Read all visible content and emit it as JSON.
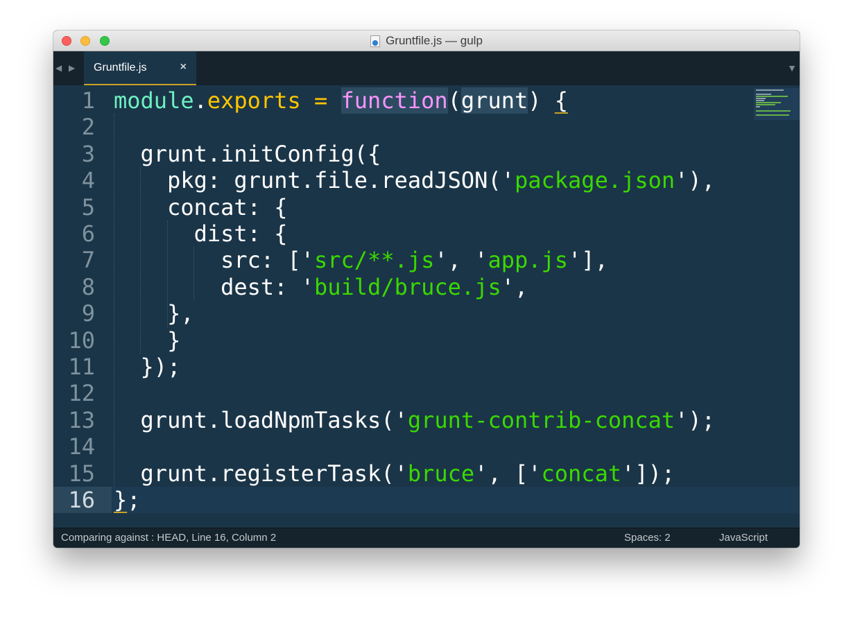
{
  "window": {
    "title": "Gruntfile.js — gulp"
  },
  "tabs": [
    {
      "label": "Gruntfile.js",
      "close": "×"
    }
  ],
  "tabbar": {
    "prev_glyph": "◀",
    "next_glyph": "▶",
    "menu_glyph": "▼"
  },
  "editor": {
    "active_line": 16,
    "lines": [
      {
        "num": "1",
        "tokens": [
          {
            "t": "module",
            "c": "#6ef0c2"
          },
          {
            "t": ".",
            "c": "#ffffff"
          },
          {
            "t": "exports",
            "c": "#ffc600"
          },
          {
            "t": " = ",
            "c": "#ffc600"
          },
          {
            "t": "function",
            "c": "#fb94ff",
            "hl": true
          },
          {
            "t": "(",
            "c": "#ffffff"
          },
          {
            "t": "grunt",
            "c": "#ffffff",
            "hl": true
          },
          {
            "t": ") ",
            "c": "#ffffff"
          },
          {
            "t": "{",
            "c": "#ffffff",
            "u": true
          }
        ]
      },
      {
        "num": "2",
        "tokens": []
      },
      {
        "num": "3",
        "tokens": [
          {
            "t": "  grunt.initConfig({",
            "c": "#ffffff"
          }
        ]
      },
      {
        "num": "4",
        "tokens": [
          {
            "t": "    pkg: grunt.file.readJSON(",
            "c": "#ffffff"
          },
          {
            "t": "'",
            "c": "#ffffff"
          },
          {
            "t": "package.json",
            "c": "#3ad900"
          },
          {
            "t": "'",
            "c": "#ffffff"
          },
          {
            "t": "),",
            "c": "#ffffff"
          }
        ]
      },
      {
        "num": "5",
        "tokens": [
          {
            "t": "    concat: {",
            "c": "#ffffff"
          }
        ]
      },
      {
        "num": "6",
        "tokens": [
          {
            "t": "      dist: {",
            "c": "#ffffff"
          }
        ]
      },
      {
        "num": "7",
        "tokens": [
          {
            "t": "        src: [",
            "c": "#ffffff"
          },
          {
            "t": "'",
            "c": "#ffffff"
          },
          {
            "t": "src/**.js",
            "c": "#3ad900"
          },
          {
            "t": "'",
            "c": "#ffffff"
          },
          {
            "t": ", ",
            "c": "#ffffff"
          },
          {
            "t": "'",
            "c": "#ffffff"
          },
          {
            "t": "app.js",
            "c": "#3ad900"
          },
          {
            "t": "'",
            "c": "#ffffff"
          },
          {
            "t": "],",
            "c": "#ffffff"
          }
        ]
      },
      {
        "num": "8",
        "tokens": [
          {
            "t": "        dest: ",
            "c": "#ffffff"
          },
          {
            "t": "'",
            "c": "#ffffff"
          },
          {
            "t": "build/bruce.js",
            "c": "#3ad900"
          },
          {
            "t": "'",
            "c": "#ffffff"
          },
          {
            "t": ",",
            "c": "#ffffff"
          }
        ]
      },
      {
        "num": "9",
        "tokens": [
          {
            "t": "    },",
            "c": "#ffffff"
          }
        ]
      },
      {
        "num": "10",
        "tokens": [
          {
            "t": "    }",
            "c": "#ffffff"
          }
        ]
      },
      {
        "num": "11",
        "tokens": [
          {
            "t": "  });",
            "c": "#ffffff"
          }
        ]
      },
      {
        "num": "12",
        "tokens": []
      },
      {
        "num": "13",
        "tokens": [
          {
            "t": "  grunt.loadNpmTasks(",
            "c": "#ffffff"
          },
          {
            "t": "'",
            "c": "#ffffff"
          },
          {
            "t": "grunt-contrib-concat",
            "c": "#3ad900"
          },
          {
            "t": "'",
            "c": "#ffffff"
          },
          {
            "t": ");",
            "c": "#ffffff"
          }
        ]
      },
      {
        "num": "14",
        "tokens": []
      },
      {
        "num": "15",
        "tokens": [
          {
            "t": "  grunt.registerTask(",
            "c": "#ffffff"
          },
          {
            "t": "'",
            "c": "#ffffff"
          },
          {
            "t": "bruce",
            "c": "#3ad900"
          },
          {
            "t": "'",
            "c": "#ffffff"
          },
          {
            "t": ", [",
            "c": "#ffffff"
          },
          {
            "t": "'",
            "c": "#ffffff"
          },
          {
            "t": "concat",
            "c": "#3ad900"
          },
          {
            "t": "'",
            "c": "#ffffff"
          },
          {
            "t": "]);",
            "c": "#ffffff"
          }
        ]
      },
      {
        "num": "16",
        "tokens": [
          {
            "t": "}",
            "c": "#ffffff",
            "u": true
          },
          {
            "t": ";",
            "c": "#ffffff"
          }
        ]
      }
    ]
  },
  "statusbar": {
    "left": "Comparing against : HEAD, Line 16, Column 2",
    "indent": "Spaces: 2",
    "syntax": "JavaScript"
  },
  "colors": {
    "background": "#1b3548",
    "string": "#3ad900",
    "keyword": "#fb94ff",
    "operator": "#ffc600",
    "module": "#6ef0c2",
    "tab_underline": "#c9a227"
  }
}
